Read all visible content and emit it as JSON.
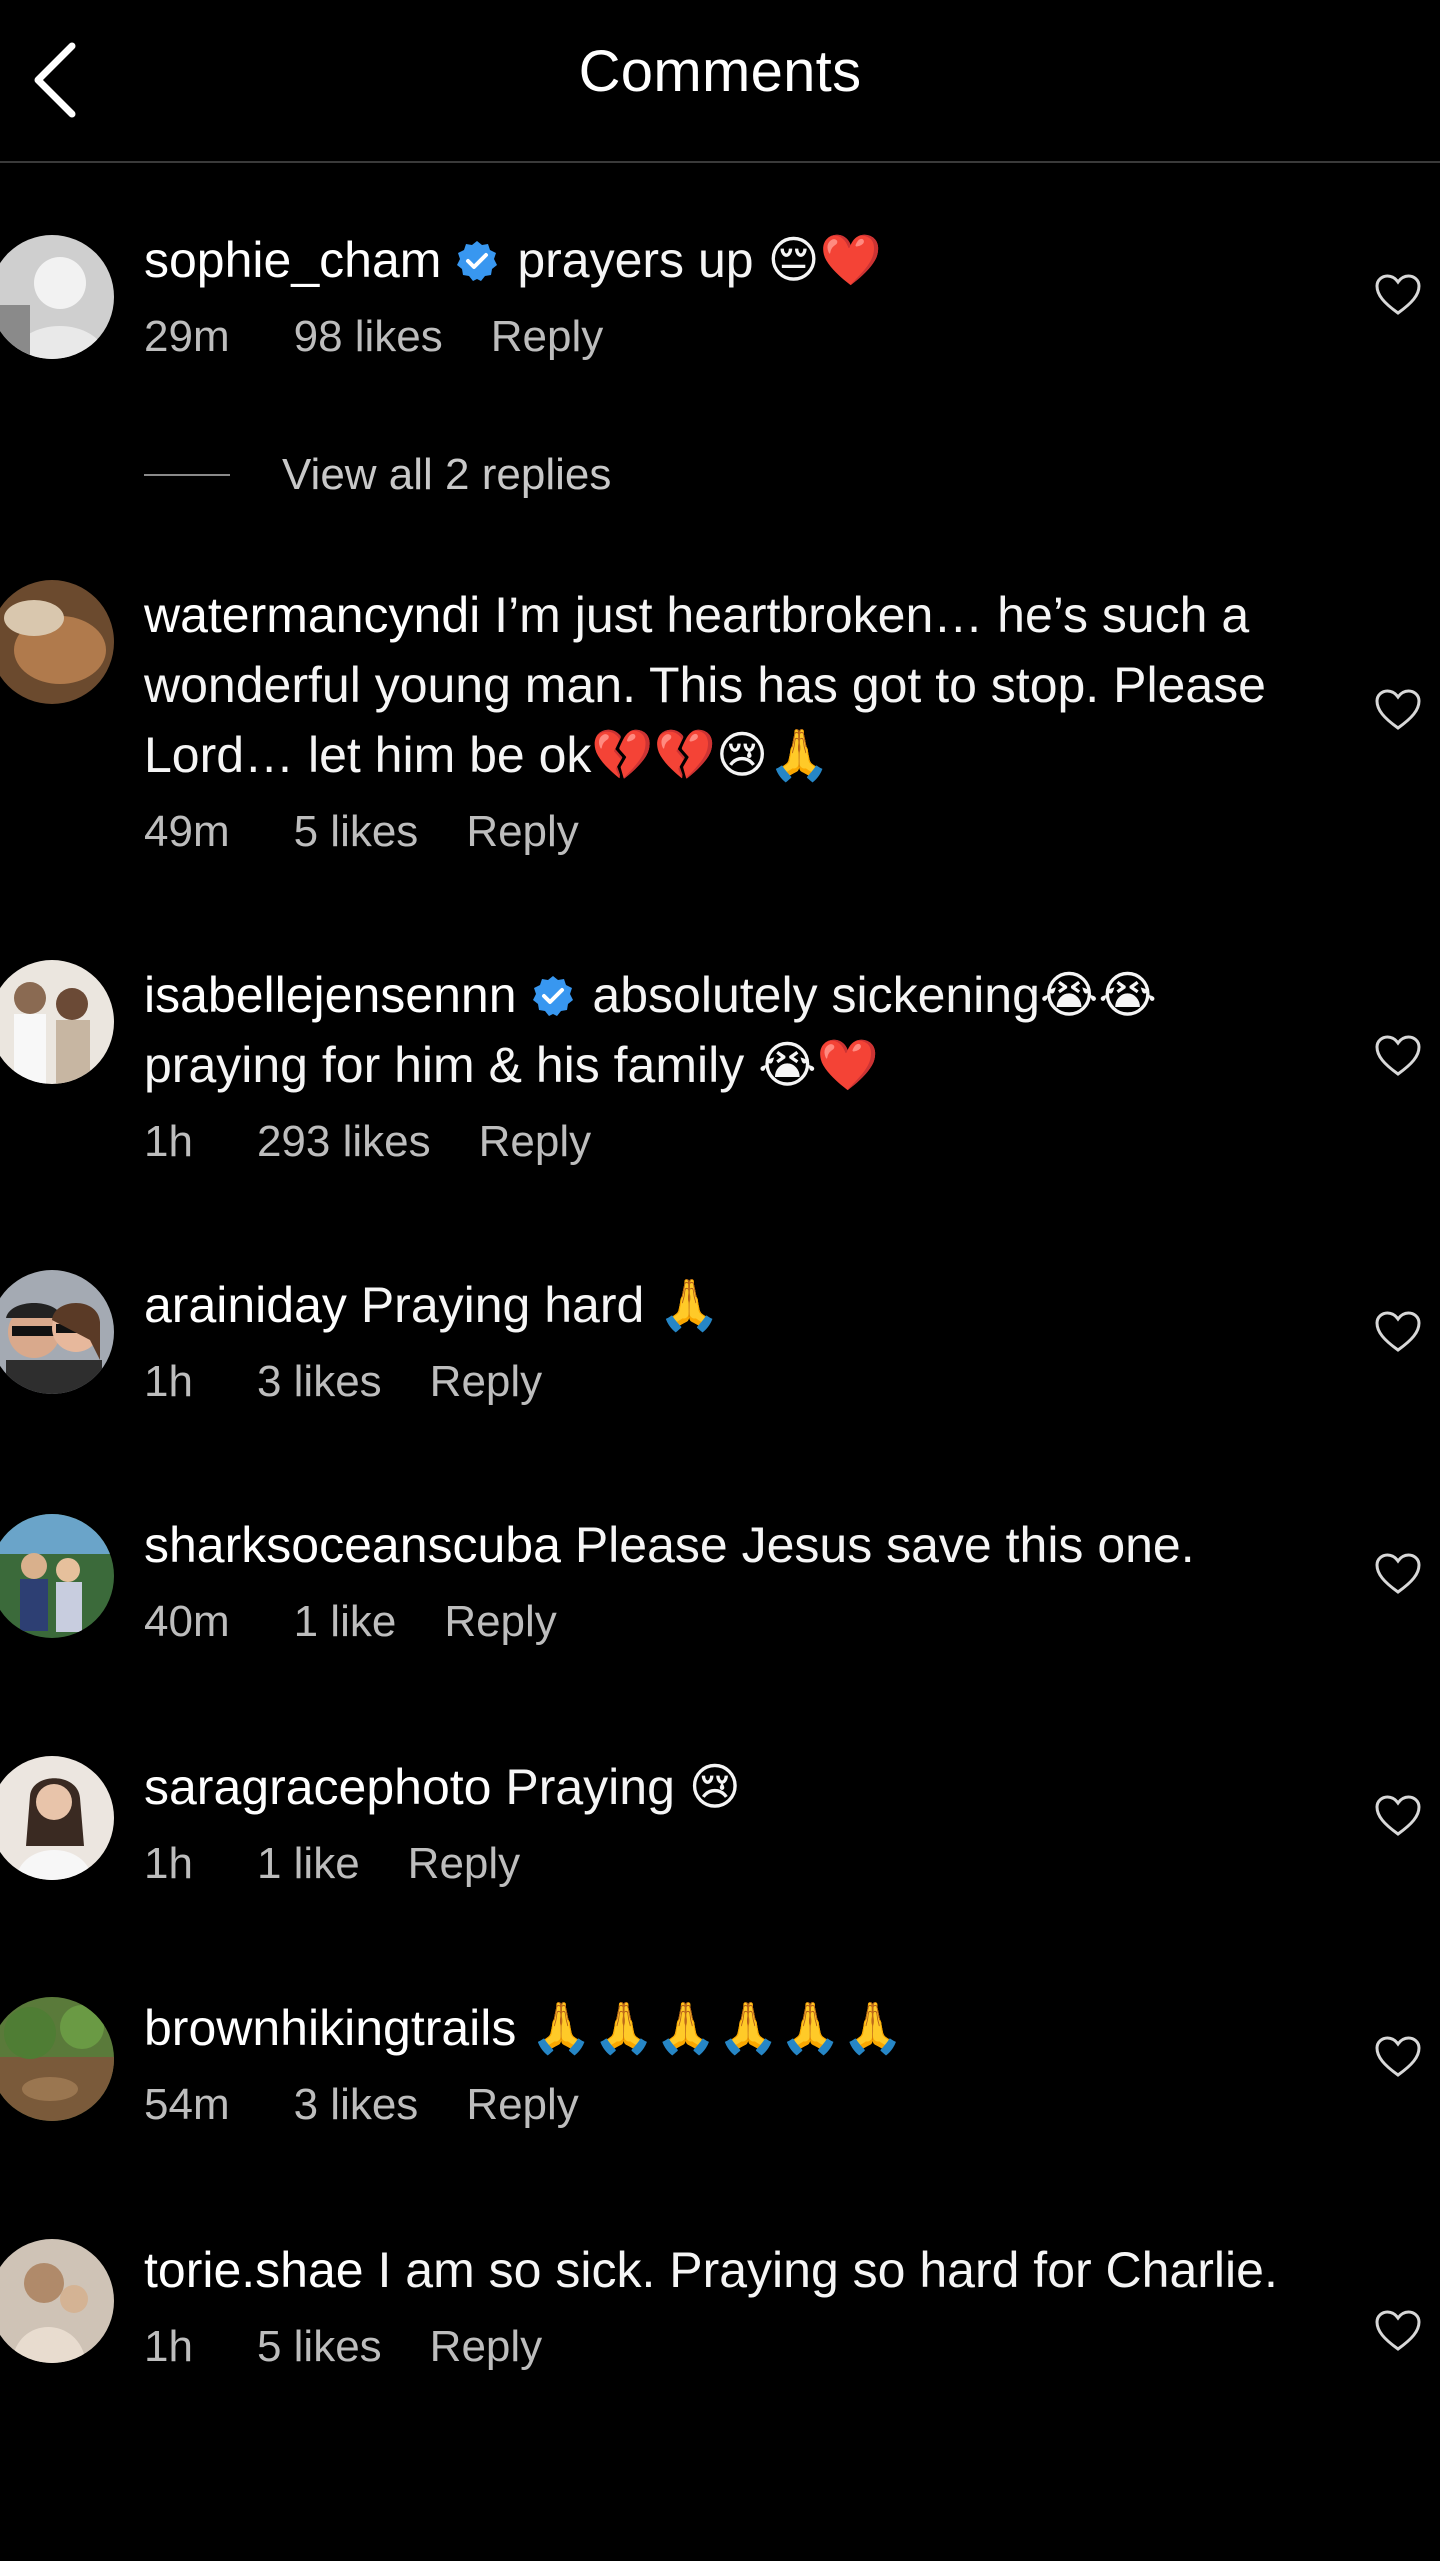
{
  "header": {
    "title": "Comments"
  },
  "comments": [
    {
      "username": "sophie_cham",
      "verified": true,
      "text": "prayers up 😔❤️",
      "time": "29m",
      "likes": "98 likes",
      "reply": "Reply"
    },
    {
      "username": "watermancyndi",
      "verified": false,
      "text": "I’m just heartbroken… he’s such a wonderful young man. This has got to stop. Please Lord… let him be ok💔💔😢🙏",
      "time": "49m",
      "likes": "5 likes",
      "reply": "Reply"
    },
    {
      "username": "isabellejensennn",
      "verified": true,
      "text": "absolutely sickening😭😭 praying for him & his family 😭❤️",
      "time": "1h",
      "likes": "293 likes",
      "reply": "Reply"
    },
    {
      "username": "arainiday",
      "verified": false,
      "text": "Praying hard 🙏",
      "time": "1h",
      "likes": "3 likes",
      "reply": "Reply"
    },
    {
      "username": "sharksoceanscuba",
      "verified": false,
      "text": "Please Jesus save this one.",
      "time": "40m",
      "likes": "1 like",
      "reply": "Reply"
    },
    {
      "username": "saragracephoto",
      "verified": false,
      "text": "Praying 😢",
      "time": "1h",
      "likes": "1 like",
      "reply": "Reply"
    },
    {
      "username": "brownhikingtrails",
      "verified": false,
      "text": "🙏🙏🙏🙏🙏🙏",
      "time": "54m",
      "likes": "3 likes",
      "reply": "Reply"
    },
    {
      "username": "torie.shae",
      "verified": false,
      "text": "I am so sick. Praying so hard for Charlie.",
      "time": "1h",
      "likes": "5 likes",
      "reply": "Reply"
    }
  ],
  "view_replies": {
    "label": "View all 2 replies"
  },
  "icons": {
    "back": "chevron-left-icon",
    "verified": "verified-badge-icon",
    "like": "heart-outline-icon"
  },
  "colors": {
    "background": "#000000",
    "verified_badge": "#3897f0",
    "meta_text": "#bdbdbd"
  }
}
